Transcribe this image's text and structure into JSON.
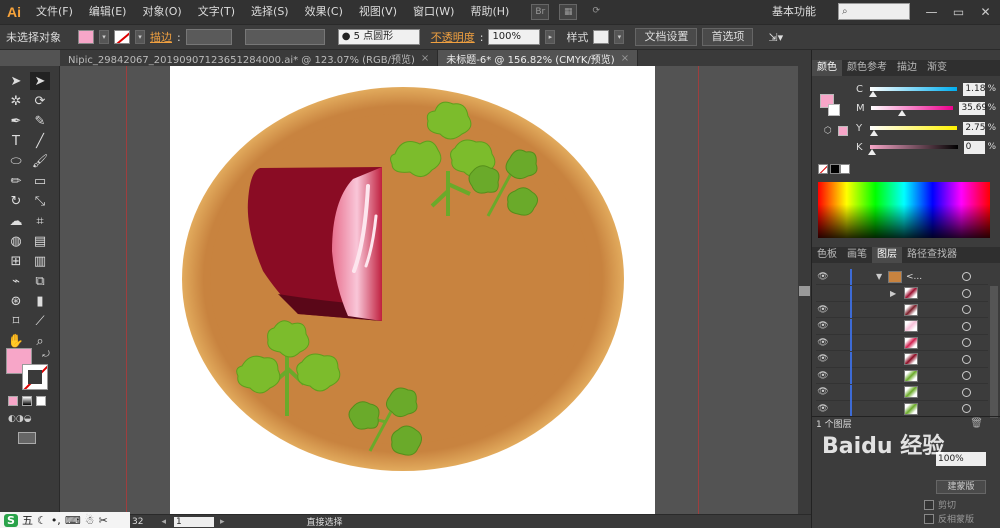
{
  "menubar": {
    "logo": "Ai",
    "items": [
      "文件(F)",
      "编辑(E)",
      "对象(O)",
      "文字(T)",
      "选择(S)",
      "效果(C)",
      "视图(V)",
      "窗口(W)",
      "帮助(H)"
    ],
    "br_label": "Br",
    "workspace": "基本功能",
    "win_min": "—",
    "win_max": "▭",
    "win_close": "✕"
  },
  "controlbar": {
    "no_selection": "未选择对象",
    "fill_color": "#f7a6c8",
    "stroke_label": "描边",
    "brush_value": "5 点圆形",
    "opacity_label": "不透明度",
    "opacity_value": "100%",
    "style_label": "样式",
    "doc_setup": "文档设置",
    "prefs": "首选项"
  },
  "tabs": [
    {
      "label": "Nipic_29842067_20190907123651284000.ai* @ 123.07% (RGB/预览)",
      "close": "×"
    },
    {
      "label": "未标题-6* @ 156.82% (CMYK/预览)",
      "close": "×"
    }
  ],
  "color_panel": {
    "tabs": [
      "颜色",
      "颜色参考",
      "描边",
      "渐变"
    ],
    "channels": [
      {
        "label": "C",
        "value": "1.18",
        "unit": "%",
        "level": 0.0118,
        "from": "#ffffff",
        "to": "#00aeef"
      },
      {
        "label": "M",
        "value": "35.69",
        "unit": "%",
        "level": 0.3569,
        "from": "#ffffff",
        "to": "#ec008c"
      },
      {
        "label": "Y",
        "value": "2.75",
        "unit": "%",
        "level": 0.0275,
        "from": "#ffffff",
        "to": "#fff200"
      },
      {
        "label": "K",
        "value": "0",
        "unit": "%",
        "level": 0,
        "from": "#f7a6c8",
        "to": "#000000"
      }
    ]
  },
  "layers_panel": {
    "tabs": [
      "色板",
      "画笔",
      "图层",
      "路径查找器"
    ],
    "group_label": "<...",
    "layer_count_label": "1 个图层",
    "thumbs": [
      "#9b1030",
      "#7a1e2a",
      "#f7c0d8",
      "#d02050",
      "#8a0c24",
      "#6aaa2a",
      "#6aaa2a",
      "#6aaa2a"
    ]
  },
  "lower_panel": {
    "opacity_value": "100%",
    "clip_label": "剪切",
    "invert_label": "反相蒙版",
    "make_mask": "建蒙版"
  },
  "status": {
    "zoom": "32",
    "page": "1",
    "tool_name": "直接选择"
  },
  "ime": {
    "logo": "S",
    "mode": "五"
  },
  "watermark": "Baidu 经验"
}
